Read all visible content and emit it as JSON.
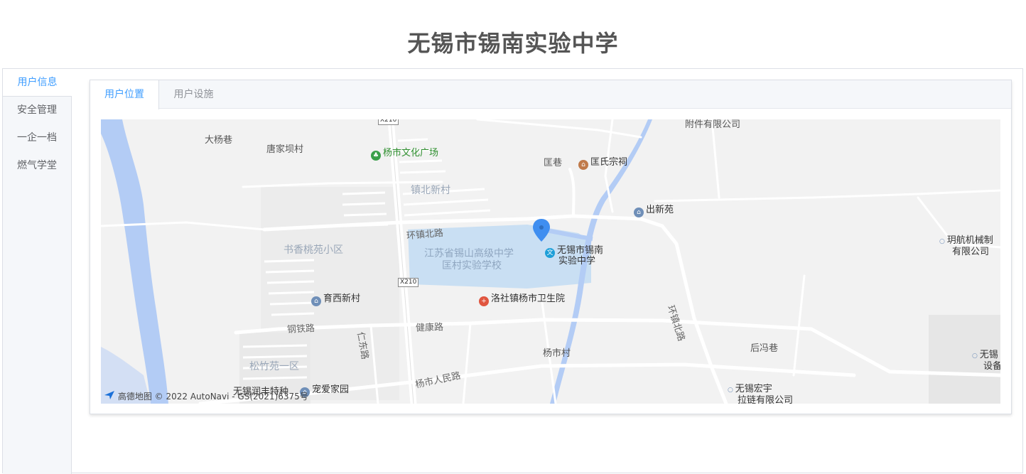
{
  "header": {
    "title": "无锡市锡南实验中学"
  },
  "sidebar": {
    "items": [
      {
        "label": "用户信息"
      },
      {
        "label": "安全管理"
      },
      {
        "label": "一企一档"
      },
      {
        "label": "燃气学堂"
      }
    ]
  },
  "tabs": [
    {
      "label": "用户位置"
    },
    {
      "label": "用户设施"
    }
  ],
  "map": {
    "marker_label": "无锡市锡南实验中学",
    "copyright": "© 2022 AutoNavi - GS(2021)6375号",
    "provider": "高德地图",
    "places": {
      "p1": "附件有限公司",
      "p2": "大杨巷",
      "p3": "唐家坝村",
      "p4": "杨市文化广场",
      "p5": "匡巷",
      "p6": "匡氏宗祠",
      "p7": "镇北新村",
      "p8": "出新苑",
      "p9": "环镇北路",
      "p10": "书香桃苑小区",
      "p11": "江苏省锡山高级中学",
      "p12": "匡村实验学校",
      "p13a": "无锡市锡南",
      "p13b": "实验中学",
      "p14a": "玥航机械制",
      "p14b": "有限公司",
      "p15": "X210",
      "p16": "育西新村",
      "p17": "洛社镇杨市卫生院",
      "p18": "钢铁路",
      "p19": "仁东路",
      "p20": "健康路",
      "p21": "环镇北路",
      "p22": "杨市村",
      "p23": "后冯巷",
      "p24a": "无锡",
      "p24b": "设备",
      "p25": "松竹苑一区",
      "p26": "杨市人民路",
      "p27": "无锡润丰特种",
      "p28": "宠爱家园",
      "p29a": "无锡宏宇",
      "p29b": "拉链有限公司",
      "p30": "X210"
    }
  },
  "colors": {
    "accent": "#409eff",
    "river": "#b3ccf5",
    "school_area": "#c9dff3",
    "marker": "#3f8ef0"
  }
}
